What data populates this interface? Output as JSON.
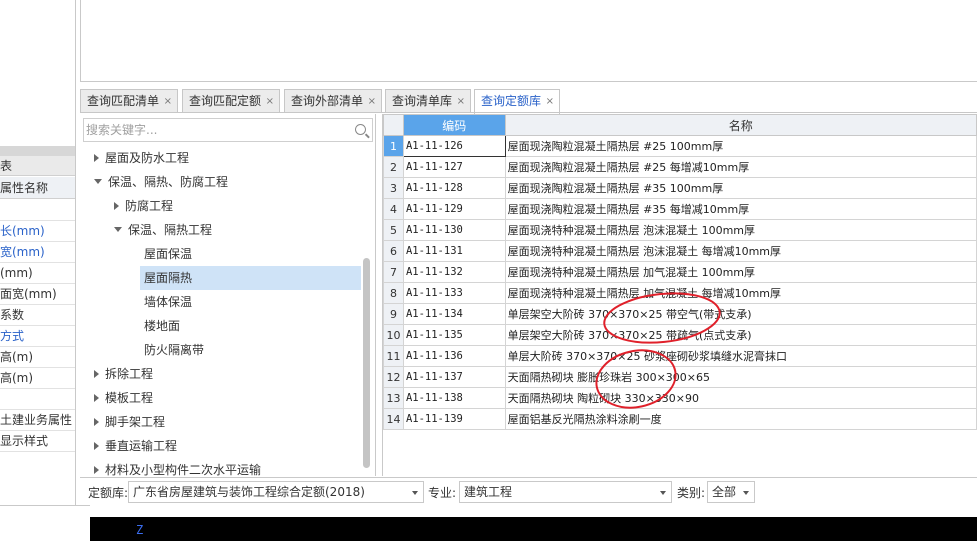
{
  "left_panel": {
    "title": "表",
    "col_header": "属性名称",
    "rows": [
      {
        "text": "",
        "blue": false
      },
      {
        "text": "长(mm)",
        "blue": true
      },
      {
        "text": "宽(mm)",
        "blue": true
      },
      {
        "text": "(mm)",
        "blue": false
      },
      {
        "text": "面宽(mm)",
        "blue": false
      },
      {
        "text": "系数",
        "blue": false
      },
      {
        "text": "方式",
        "blue": true
      },
      {
        "text": "高(m)",
        "blue": false
      },
      {
        "text": "高(m)",
        "blue": false
      },
      {
        "text": "",
        "blue": false
      },
      {
        "text": "土建业务属性",
        "blue": false
      },
      {
        "text": "显示样式",
        "blue": false
      }
    ]
  },
  "tabs": [
    {
      "label": "查询匹配清单",
      "close": "×",
      "active": false
    },
    {
      "label": "查询匹配定额",
      "close": "×",
      "active": false
    },
    {
      "label": "查询外部清单",
      "close": "×",
      "active": false
    },
    {
      "label": "查询清单库",
      "close": "×",
      "active": false
    },
    {
      "label": "查询定额库",
      "close": "×",
      "active": true
    }
  ],
  "search": {
    "placeholder": "搜索关键字..."
  },
  "tree": [
    {
      "label": "屋面及防水工程",
      "level": 0,
      "arrow": "right",
      "selected": false
    },
    {
      "label": "保温、隔热、防腐工程",
      "level": 0,
      "arrow": "down",
      "selected": false
    },
    {
      "label": "防腐工程",
      "level": 1,
      "arrow": "right",
      "selected": false
    },
    {
      "label": "保温、隔热工程",
      "level": 1,
      "arrow": "down",
      "selected": false
    },
    {
      "label": "屋面保温",
      "level": 2,
      "arrow": "",
      "selected": false
    },
    {
      "label": "屋面隔热",
      "level": 2,
      "arrow": "",
      "selected": true
    },
    {
      "label": "墙体保温",
      "level": 2,
      "arrow": "",
      "selected": false
    },
    {
      "label": "楼地面",
      "level": 2,
      "arrow": "",
      "selected": false
    },
    {
      "label": "防火隔离带",
      "level": 2,
      "arrow": "",
      "selected": false
    },
    {
      "label": "拆除工程",
      "level": 0,
      "arrow": "right",
      "selected": false
    },
    {
      "label": "模板工程",
      "level": 0,
      "arrow": "right",
      "selected": false
    },
    {
      "label": "脚手架工程",
      "level": 0,
      "arrow": "right",
      "selected": false
    },
    {
      "label": "垂直运输工程",
      "level": 0,
      "arrow": "right",
      "selected": false
    },
    {
      "label": "材料及小型构件二次水平运输",
      "level": 0,
      "arrow": "right",
      "selected": false
    }
  ],
  "table": {
    "headers": {
      "index": "",
      "code": "编码",
      "name": "名称"
    },
    "rows": [
      {
        "index": "1",
        "code": "A1-11-126",
        "name": "屋面现浇陶粒混凝土隔热层 #25 100mm厚"
      },
      {
        "index": "2",
        "code": "A1-11-127",
        "name": "屋面现浇陶粒混凝土隔热层 #25 每增减10mm厚"
      },
      {
        "index": "3",
        "code": "A1-11-128",
        "name": "屋面现浇陶粒混凝土隔热层 #35 100mm厚"
      },
      {
        "index": "4",
        "code": "A1-11-129",
        "name": "屋面现浇陶粒混凝土隔热层 #35 每增减10mm厚"
      },
      {
        "index": "5",
        "code": "A1-11-130",
        "name": "屋面现浇特种混凝土隔热层 泡沫混凝土 100mm厚"
      },
      {
        "index": "6",
        "code": "A1-11-131",
        "name": "屋面现浇特种混凝土隔热层 泡沫混凝土 每增减10mm厚"
      },
      {
        "index": "7",
        "code": "A1-11-132",
        "name": "屋面现浇特种混凝土隔热层 加气混凝土 100mm厚"
      },
      {
        "index": "8",
        "code": "A1-11-133",
        "name": "屋面现浇特种混凝土隔热层 加气混凝土 每增减10mm厚"
      },
      {
        "index": "9",
        "code": "A1-11-134",
        "name": "单层架空大阶砖 370×370×25 带空气(带式支承)"
      },
      {
        "index": "10",
        "code": "A1-11-135",
        "name": "单层架空大阶砖 370×370×25 带疏气(点式支承)"
      },
      {
        "index": "11",
        "code": "A1-11-136",
        "name": "单层大阶砖 370×370×25 砂浆座砌砂浆填缝水泥膏抹口"
      },
      {
        "index": "12",
        "code": "A1-11-137",
        "name": "天面隔热砌块 膨胀珍珠岩 300×300×65"
      },
      {
        "index": "13",
        "code": "A1-11-138",
        "name": "天面隔热砌块 陶粒砌块 330×330×90"
      },
      {
        "index": "14",
        "code": "A1-11-139",
        "name": "屋面铝基反光隔热涂料涂刷一度"
      }
    ],
    "selected_row": 0
  },
  "bottom": {
    "quota_label": "定额库:",
    "quota_value": "广东省房屋建筑与装饰工程综合定额(2018)",
    "major_label": "专业:",
    "major_value": "建筑工程",
    "category_label": "类别:",
    "category_value": "全部"
  },
  "taskbar": {
    "text": "Z"
  },
  "colors": {
    "accent": "#5aa4ea",
    "link_blue": "#2a62c9",
    "annotation_red": "#e0202a"
  }
}
